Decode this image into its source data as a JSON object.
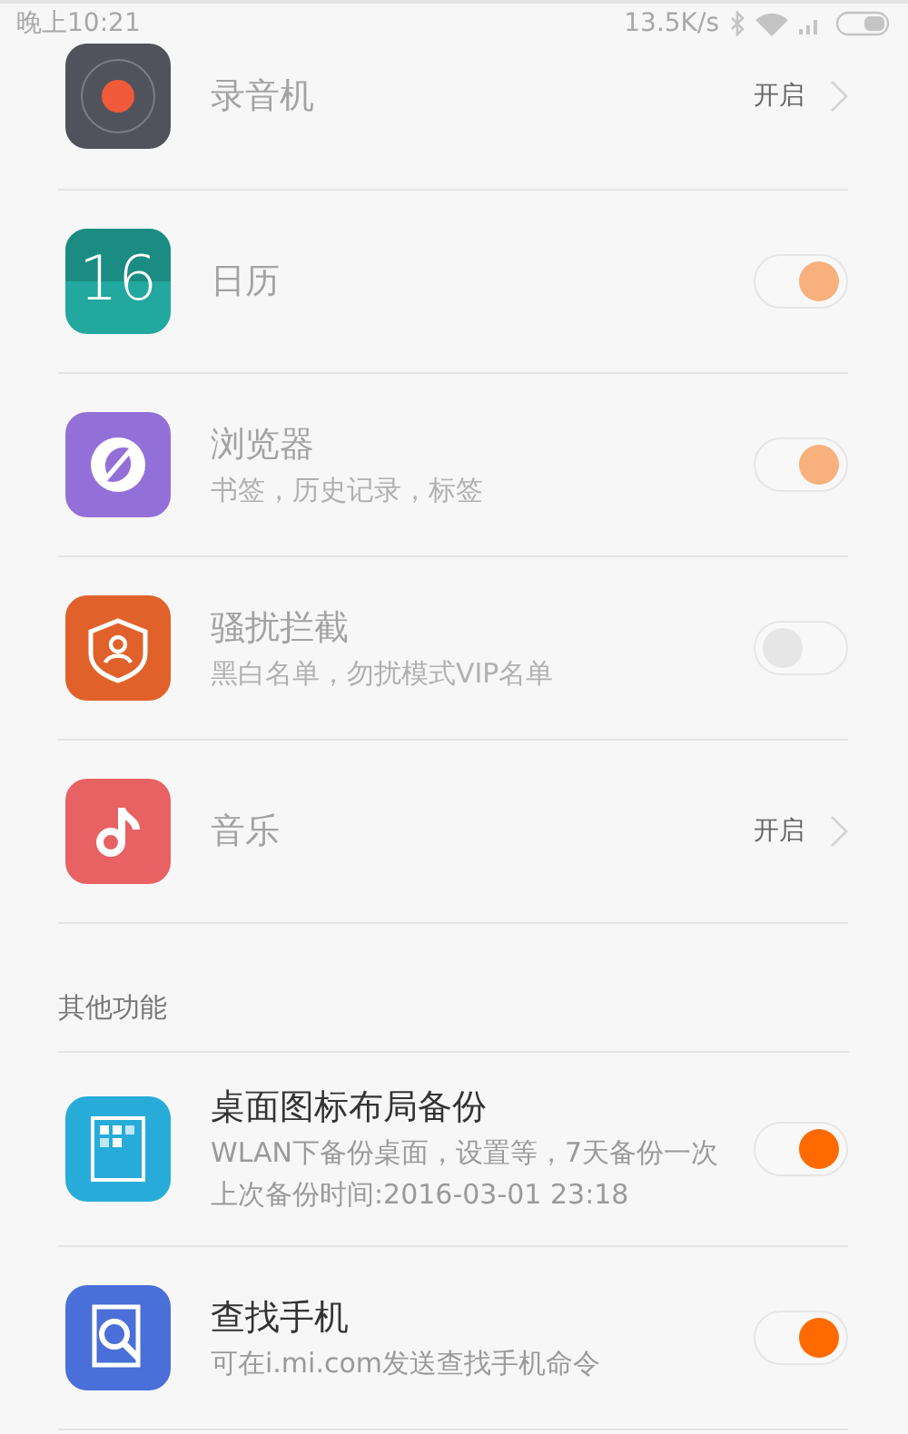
{
  "status_bar": {
    "time": "晚上10:21",
    "speed": "13.5K/s"
  },
  "groups": [
    {
      "items": [
        {
          "title": "录音机",
          "disabled": true,
          "kind": "link",
          "value": "开启"
        },
        {
          "icon_text": "16",
          "title": "日历",
          "disabled": true,
          "kind": "switch",
          "on": true
        },
        {
          "title": "浏览器",
          "subtitle": "书签，历史记录，标签",
          "disabled": true,
          "kind": "switch",
          "on": true
        },
        {
          "title": "骚扰拦截",
          "subtitle": "黑白名单，勿扰模式VIP名单",
          "disabled": true,
          "kind": "switch",
          "on": false
        },
        {
          "title": "音乐",
          "disabled": true,
          "kind": "link",
          "value": "开启"
        }
      ]
    },
    {
      "header": "其他功能",
      "items": [
        {
          "title": "桌面图标布局备份",
          "subtitle": "WLAN下备份桌面，设置等，7天备份一次",
          "note": "上次备份时间:2016-03-01 23:18",
          "disabled": false,
          "kind": "switch",
          "on": true
        },
        {
          "title": "查找手机",
          "subtitle": "可在i.mi.com发送查找手机命令",
          "disabled": false,
          "kind": "switch",
          "on": true
        }
      ]
    }
  ]
}
